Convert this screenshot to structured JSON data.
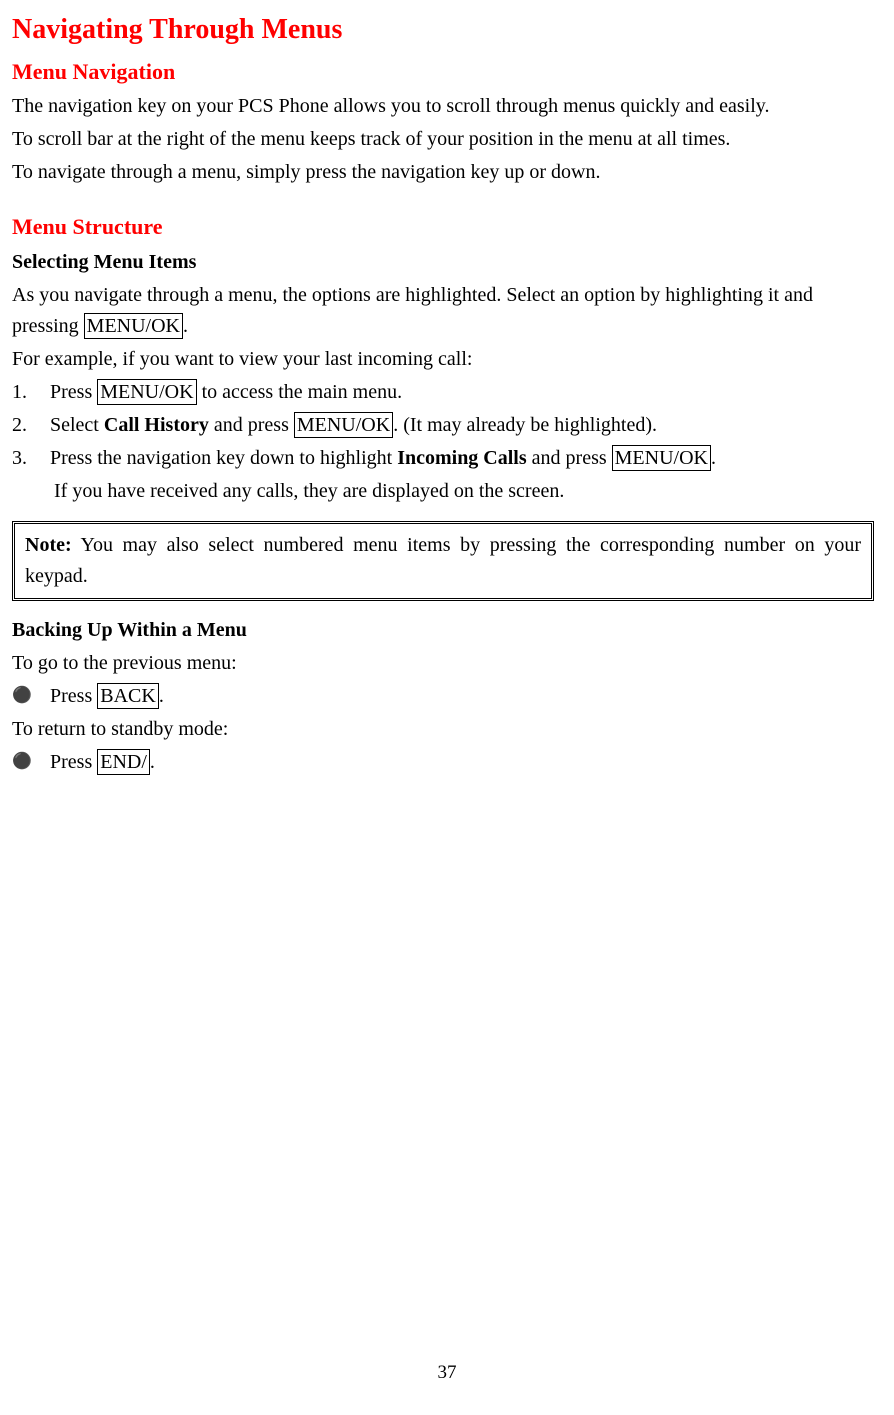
{
  "title": "Navigating Through Menus",
  "section1": {
    "heading": "Menu Navigation",
    "p1": "The navigation key on your PCS Phone allows you to scroll through menus quickly and easily.",
    "p2": "To scroll bar at the right of the menu keeps track of your position in the menu at all times.",
    "p3": "To navigate through a menu, simply press the navigation key up or down."
  },
  "section2": {
    "heading": "Menu Structure",
    "sub1": "Selecting Menu Items",
    "p1a": "As you navigate through a menu, the options are highlighted. Select an option by highlighting it and pressing ",
    "key_menu_ok": "MENU/OK",
    "p1b": ".",
    "p2": "For example, if you want to view your last incoming call:",
    "steps": [
      {
        "num": "1.",
        "pre": "Press ",
        "key": "MENU/OK",
        "post": " to access the main menu."
      },
      {
        "num": "2.",
        "pre": "Select ",
        "bold": "Call History",
        "mid": " and press ",
        "key": "MENU/OK",
        "post": ". (It may already be highlighted)."
      },
      {
        "num": "3.",
        "pre": "Press the navigation key down to highlight ",
        "bold": "Incoming Calls",
        "mid": " and press ",
        "key": "MENU/OK",
        "post": "."
      }
    ],
    "step3_extra": "If you have received any calls, they are displayed on the screen.",
    "note_label": "Note:",
    "note_text": " You may also select numbered menu items by pressing the corresponding number on your keypad.",
    "sub2": "Backing Up Within a Menu",
    "back_p1": "To go to the previous menu:",
    "back_bullet1_pre": "Press ",
    "back_bullet1_key": "BACK",
    "back_bullet1_post": ".",
    "back_p2": "To return to standby mode:",
    "back_bullet2_pre": "Press ",
    "back_bullet2_key": "END/",
    "back_bullet2_post": "."
  },
  "page_number": "37"
}
